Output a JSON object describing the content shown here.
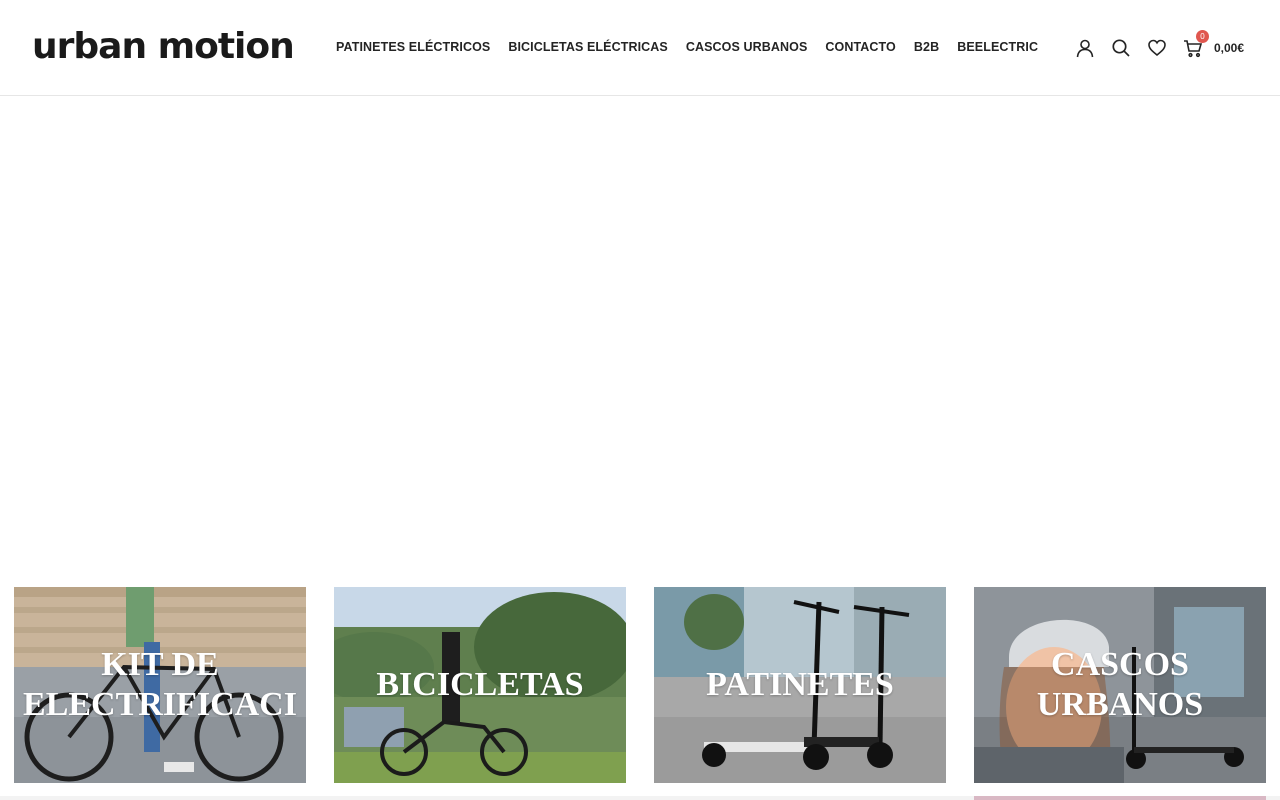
{
  "header": {
    "logo": "urban motion",
    "nav": [
      {
        "label": "PATINETES ELÉCTRICOS"
      },
      {
        "label": "BICICLETAS ELÉCTRICAS"
      },
      {
        "label": "CASCOS URBANOS"
      },
      {
        "label": "CONTACTO"
      },
      {
        "label": "B2B"
      },
      {
        "label": "BEELECTRIC"
      }
    ],
    "tools": {
      "account_icon": "user-icon",
      "search_icon": "search-icon",
      "wishlist_icon": "heart-icon",
      "cart_icon": "cart-icon",
      "cart_count": "0",
      "cart_total": "0,00€"
    }
  },
  "categories": [
    {
      "title": "KIT DE\nELECTRIFICACI"
    },
    {
      "title": "BICICLETAS"
    },
    {
      "title": "PATINETES"
    },
    {
      "title": "CASCOS\nURBANOS"
    }
  ],
  "colors": {
    "badge": "#e0574f",
    "text": "#242424"
  }
}
